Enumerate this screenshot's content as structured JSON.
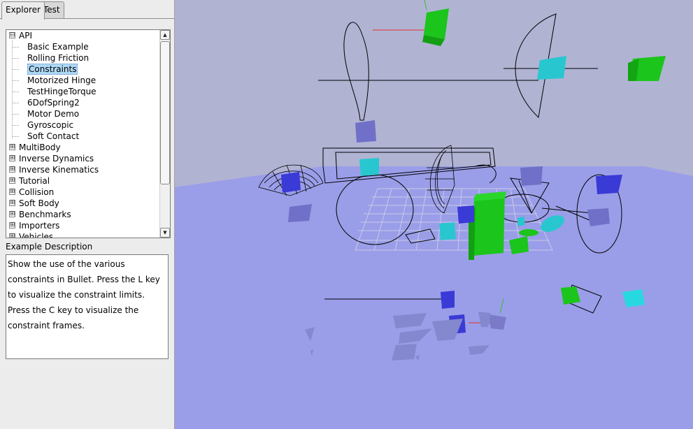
{
  "tabs": [
    {
      "label": "Explorer",
      "active": true
    },
    {
      "label": "Test",
      "active": false
    }
  ],
  "tree": {
    "root": {
      "label": "API",
      "expanded": true
    },
    "api_items": [
      {
        "label": "Basic Example"
      },
      {
        "label": "Rolling Friction"
      },
      {
        "label": "Constraints",
        "selected": true
      },
      {
        "label": "Motorized Hinge"
      },
      {
        "label": "TestHingeTorque"
      },
      {
        "label": "6DofSpring2"
      },
      {
        "label": "Motor Demo"
      },
      {
        "label": "Gyroscopic"
      },
      {
        "label": "Soft Contact"
      }
    ],
    "categories": [
      {
        "label": "MultiBody"
      },
      {
        "label": "Inverse Dynamics"
      },
      {
        "label": "Inverse Kinematics"
      },
      {
        "label": "Tutorial"
      },
      {
        "label": "Collision"
      },
      {
        "label": "Soft Body"
      },
      {
        "label": "Benchmarks"
      },
      {
        "label": "Importers"
      },
      {
        "label": "Vehicles"
      }
    ],
    "expand_glyph": "⊞",
    "collapse_glyph": "⊟"
  },
  "description": {
    "label": "Example Description",
    "lines": [
      "Show the use of the various",
      "constraints in Bullet. Press the L key",
      "to visualize the constraint limits.",
      "Press the C key to visualize the",
      "constraint frames."
    ]
  },
  "colors": {
    "sky": "#b1b3d3",
    "floor": "#9a9ee8",
    "green": "#1bc51b",
    "cyan": "#28c7d0",
    "blue": "#3a3ad6",
    "wire": "#000000",
    "selection": "#aed8f5"
  }
}
